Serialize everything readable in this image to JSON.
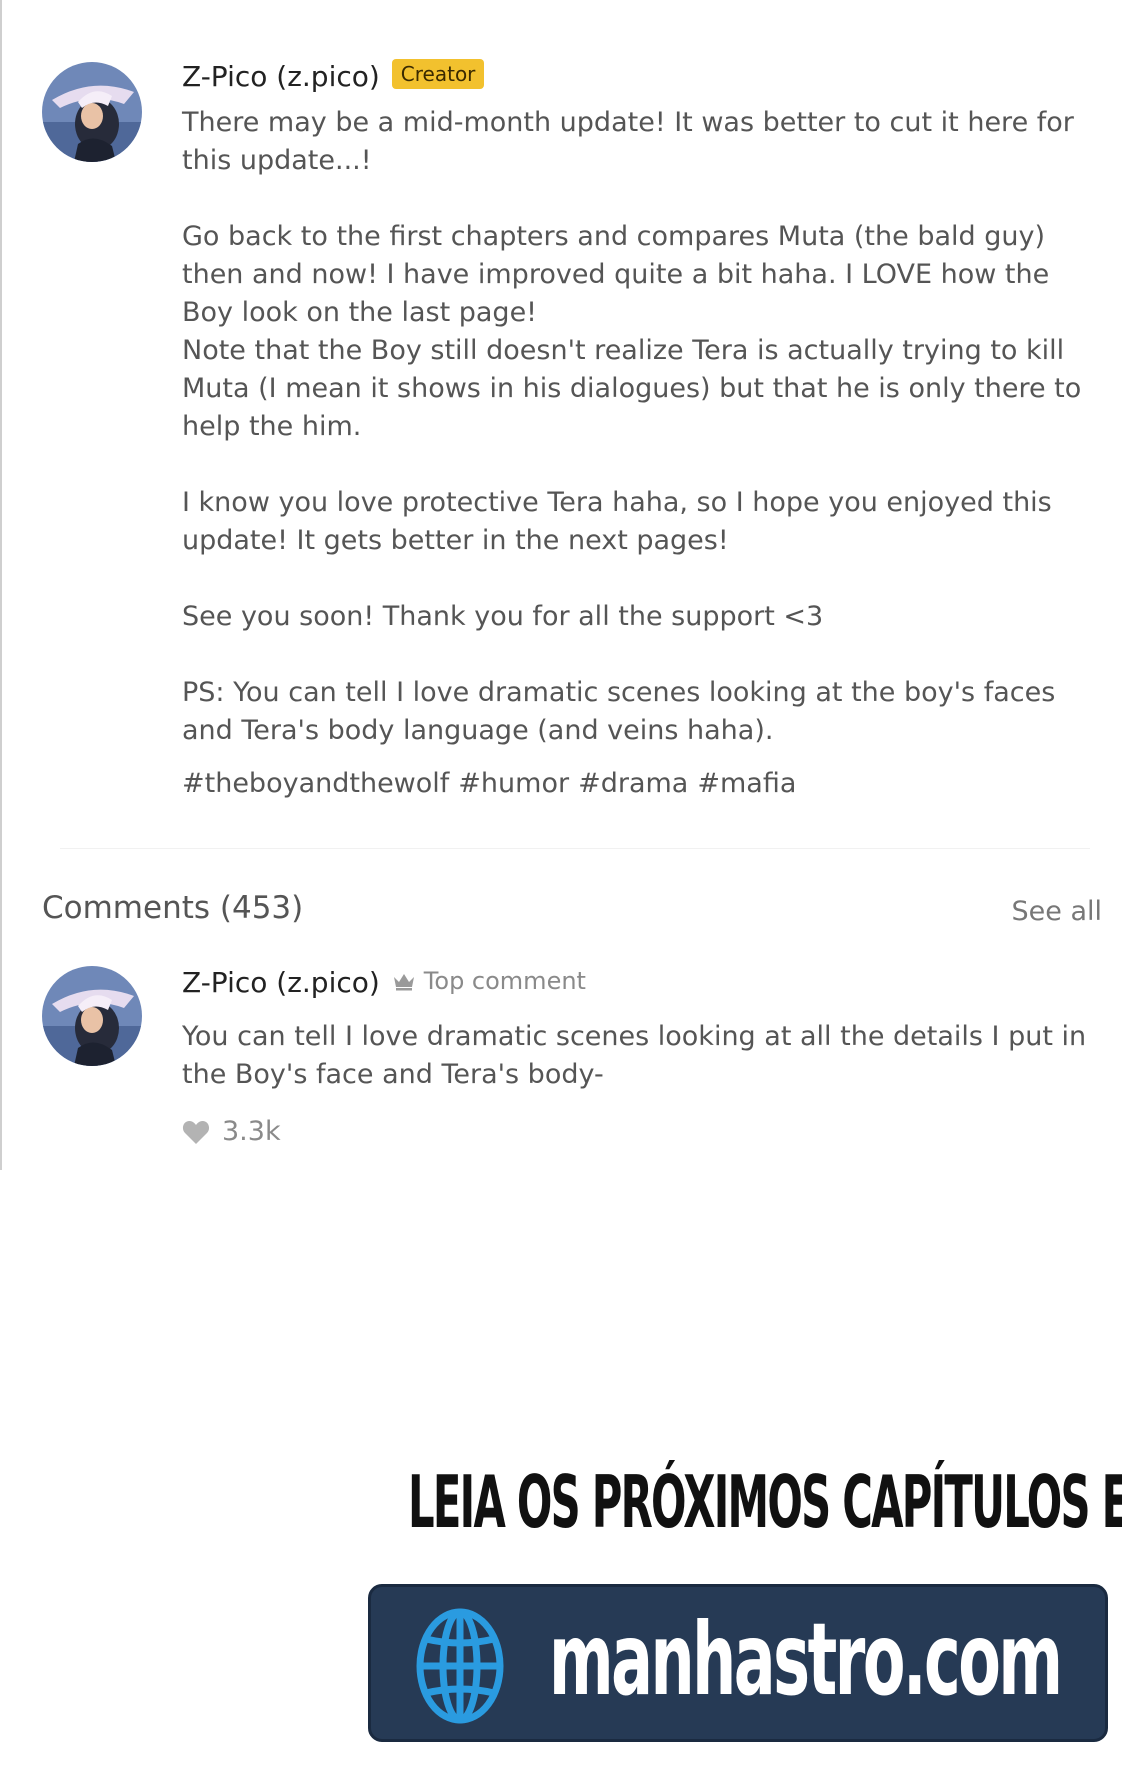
{
  "post": {
    "author_name": "Z-Pico (z.pico)",
    "badge": "Creator",
    "paragraphs": [
      "There may be a mid-month update! It was better to cut it here for this update...!",
      "",
      "Go back to the first chapters and compares Muta (the bald guy) then and now! I have improved quite a bit haha. I LOVE how the Boy look on the last page!",
      "Note that the Boy still doesn't realize Tera is actually trying to kill Muta (I mean it shows in his dialogues) but that he is only there to help the him.",
      "",
      "I know you love protective Tera haha, so I hope you enjoyed this update! It gets better in the next pages!",
      "",
      "See you soon! Thank you for all the support <3",
      "",
      "PS: You can tell I love dramatic scenes looking at the boy's faces and Tera's body language (and veins haha)."
    ],
    "hashtags": [
      "#theboyandthewolf",
      "#humor",
      "#drama",
      "#mafia"
    ]
  },
  "comments": {
    "title": "Comments (453)",
    "see_all": "See all",
    "top": {
      "author_name": "Z-Pico (z.pico)",
      "badge": "Top comment",
      "text": "You can tell I love dramatic scenes looking at all the details I put in the Boy's face and Tera's body-",
      "likes": "3.3k"
    }
  },
  "promo": {
    "headline": "LEIA OS PRÓXIMOS CAPÍTULOS EM",
    "site": "manhastro.com"
  },
  "colors": {
    "badge_creator": "#f2c12e",
    "promo_banner": "#263a55",
    "globe": "#2a9be0"
  },
  "icons": {
    "avatar": "avatar-illustration",
    "top_comment": "crown-icon",
    "like": "heart-icon",
    "promo": "globe-icon"
  }
}
